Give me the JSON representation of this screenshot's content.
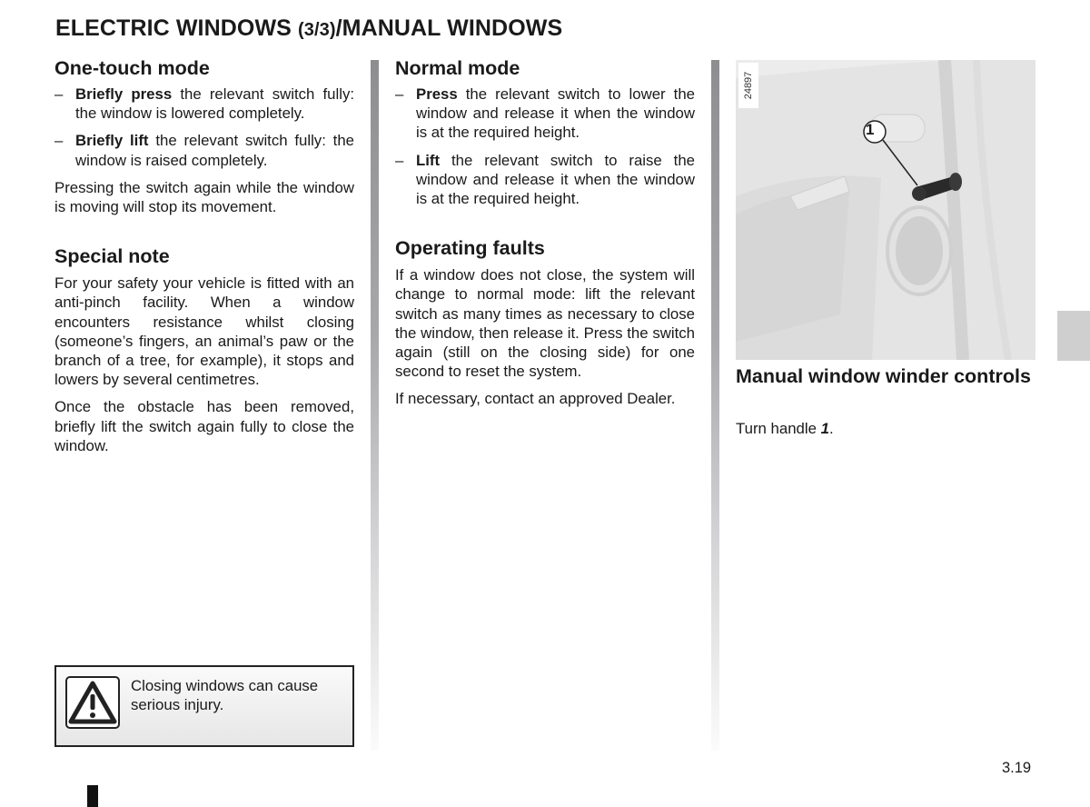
{
  "page": {
    "title_part1": "ELECTRIC WINDOWS ",
    "title_part2": "(3/3)",
    "title_part3": "/MANUAL WINDOWS",
    "page_number": "3.19"
  },
  "col1": {
    "one_touch": {
      "heading": "One-touch mode",
      "items": [
        {
          "bold": "Briefly press",
          "text": " the relevant switch fully: the window is lowered completely."
        },
        {
          "bold": "Briefly lift",
          "text": " the relevant switch fully: the window is raised completely."
        }
      ],
      "paragraph": "Pressing the switch again while the window is moving will stop its movement."
    },
    "special_note": {
      "heading": "Special note",
      "paragraphs": [
        "For your safety your vehicle is fitted with an anti-pinch facility. When a window encounters resistance whilst closing (someone’s fingers, an animal’s paw or the branch of a tree, for example), it stops and lowers by several centimetres.",
        "Once the obstacle has been removed, briefly lift the switch again fully to close the window."
      ]
    },
    "warning": {
      "icon": "warning-triangle-icon",
      "text": "Closing windows can cause serious injury."
    }
  },
  "col2": {
    "normal_mode": {
      "heading": "Normal mode",
      "items": [
        {
          "bold": "Press",
          "text": " the relevant switch to lower the window and release it when the window is at the required height."
        },
        {
          "bold": "Lift",
          "text": " the relevant switch to raise the window and release it when the window is at the required height."
        }
      ]
    },
    "operating_faults": {
      "heading": "Operating faults",
      "paragraphs": [
        "If a window does not close, the system will change to normal mode: lift the relevant switch as many times as necessary to close the window, then release it. Press the switch again (still on the closing side) for one second to reset the system.",
        "If necessary, contact an approved Dealer."
      ]
    }
  },
  "col3": {
    "figure": {
      "number": "24897",
      "callout": "1",
      "description": "Rear door panel with manual window winder handle"
    },
    "caption_title": "Manual window winder controls",
    "caption_text_prefix": "Turn handle ",
    "caption_text_ref": "1",
    "caption_text_suffix": "."
  },
  "dash": "–"
}
